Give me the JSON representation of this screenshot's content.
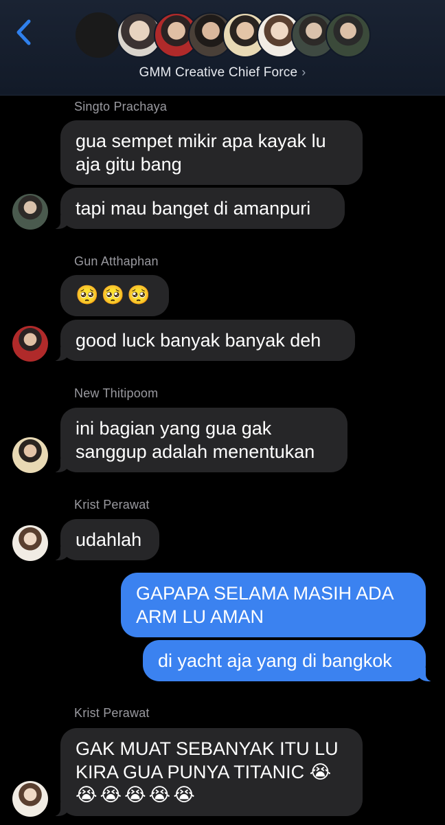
{
  "header": {
    "group_name": "GMM Creative Chief Force",
    "chevron": "›",
    "back_icon": "chevron-left-icon",
    "member_avatars": 8
  },
  "messages": [
    {
      "sender": "Singto Prachaya",
      "lines": [
        "gua sempet mikir apa kayak lu",
        "aja gitu bang"
      ]
    },
    {
      "text": "tapi mau banget di amanpuri"
    },
    {
      "sender": "Gun Atthaphan",
      "text": "🥺🥺🥺"
    },
    {
      "text": "good luck banyak banyak deh"
    },
    {
      "sender": "New Thitipoom",
      "lines": [
        "ini bagian yang gua gak",
        "sanggup adalah menentukan"
      ]
    },
    {
      "sender": "Krist Perawat",
      "text": "udahlah"
    },
    {
      "lines": [
        "GAPAPA SELAMA MASIH ADA",
        "ARM LU AMAN"
      ]
    },
    {
      "text": "di yacht aja yang di bangkok"
    },
    {
      "sender": "Krist Perawat",
      "lines": [
        "GAK MUAT SEBANYAK ITU LU",
        "KIRA GUA PUNYA TITANIC 😭",
        "😭😭😭😭😭"
      ]
    }
  ],
  "colors": {
    "incoming_bubble": "#262628",
    "outgoing_bubble": "#3b82f0",
    "accent": "#2f80ed",
    "sender_label": "#9a9aa0"
  }
}
